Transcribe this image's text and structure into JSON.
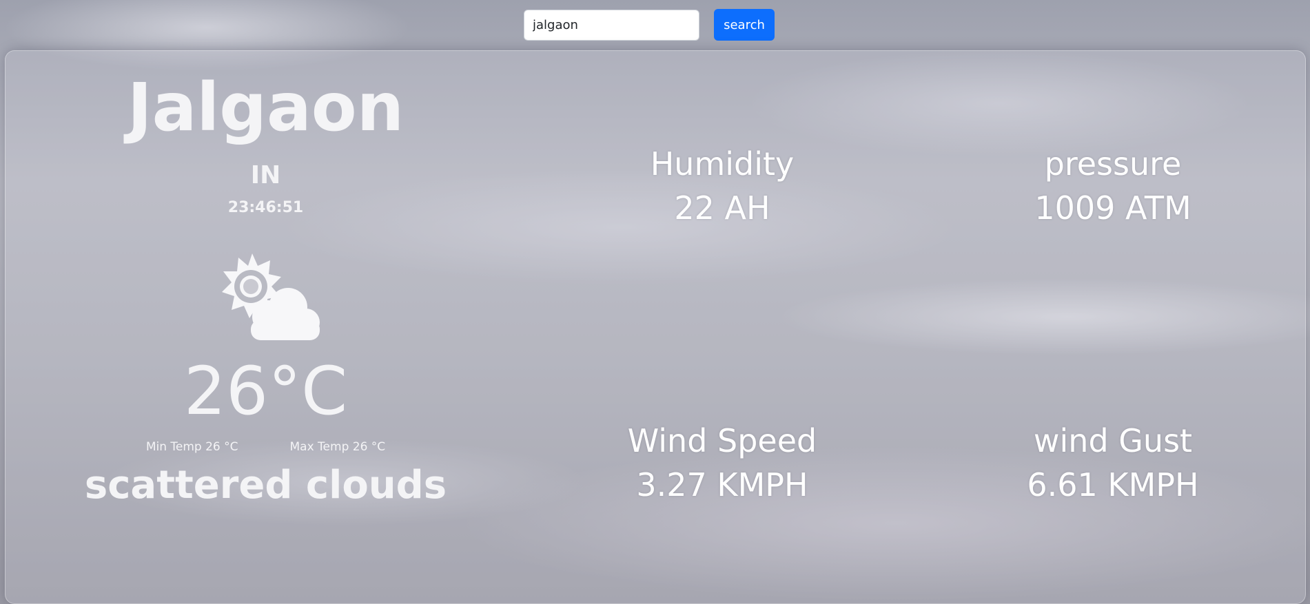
{
  "search": {
    "value": "jalgaon",
    "button_label": "search"
  },
  "location": {
    "city": "Jalgaon",
    "country": "IN",
    "time": "23:46:51"
  },
  "weather": {
    "icon": "partly-cloudy-day-icon",
    "temperature": "26°C",
    "min_temp": "Min Temp 26 °C",
    "max_temp": "Max Temp 26 °C",
    "description": "scattered clouds"
  },
  "stats": {
    "humidity": {
      "label": "Humidity",
      "value": "22 AH"
    },
    "pressure": {
      "label": "pressure",
      "value": "1009 ATM"
    },
    "wind_speed": {
      "label": "Wind Speed",
      "value": "3.27 KMPH"
    },
    "wind_gust": {
      "label": "wind Gust",
      "value": "6.61 KMPH"
    }
  },
  "colors": {
    "accent": "#0d6efd",
    "text": "#ffffff"
  }
}
